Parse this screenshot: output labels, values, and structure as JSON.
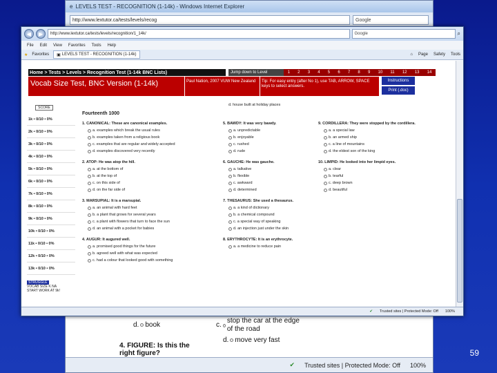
{
  "back_window": {
    "title": "LEVELS TEST - RECOGNITION (1-14k) - Windows Internet Explorer",
    "address": "http://www.lextutor.ca/tests/levels/recog",
    "search_placeholder": "Google",
    "page_lines": [
      {
        "id": "d",
        "text": "book"
      },
      {
        "id": "c",
        "text": "stop the car at the edge of the road"
      },
      {
        "id": "d2",
        "text": "move very fast"
      },
      {
        "id": "q4",
        "text": "4. FIGURE: Is this the right figure?"
      }
    ],
    "status_zone": "Trusted sites | Protected Mode: Off",
    "zoom": "100%"
  },
  "front_window": {
    "address": "http://www.lextutor.ca/tests/levels/recognition/1_14k/",
    "search_placeholder": "Google",
    "menu": [
      "File",
      "Edit",
      "View",
      "Favorites",
      "Tools",
      "Help"
    ],
    "favorites": "Favorites",
    "tab": "LEVELS TEST - RECOGNITION (1-14k)",
    "tools": [
      "Page",
      "Safety",
      "Tools"
    ],
    "status_zone": "Trusted sites | Protected Mode: Off",
    "zoom": "100%"
  },
  "page": {
    "breadcrumb": "Home > Tests > Levels > Recognition Test (1-14k BNC Lists)",
    "jump_label": "Jump down to Level",
    "levels": [
      "1",
      "2",
      "3",
      "4",
      "5",
      "6",
      "7",
      "8",
      "9",
      "10",
      "11",
      "12",
      "13",
      "14"
    ],
    "title": "Vocab Size Test, BNC Version (1-14k)",
    "author": "Paul Nation, 2007 VUW New Zealand",
    "tip": "Tip: For easy entry (after No 1), use TAB, ARROW, SPACE keys to select answers.",
    "instructions": "Instructions",
    "print": "Print (.doc)",
    "score": "SCORE",
    "levels_sidebar": [
      "1k • 0/10 • 0%",
      "2k • 0/10 • 0%",
      "3k • 0/10 • 0%",
      "4k • 0/10 • 0%",
      "5k • 0/10 • 0%",
      "6k • 0/10 • 0%",
      "7k • 0/10 • 0%",
      "8k • 0/10 • 0%",
      "9k • 0/10 • 0%",
      "10k • 0/10 • 0%",
      "11k • 0/10 • 0%",
      "12k • 0/10 • 0%",
      "13k • 0/10 • 0%"
    ],
    "struggle": {
      "label": "STRUGGLE",
      "text": "VOCAB SIZE K NA START WORK AT 9k!"
    },
    "carry_over": "d. house built at holiday places",
    "section": "Fourteenth 1000",
    "col1": [
      {
        "h": "1. CANONICAL: These are canonical examples.",
        "o": [
          "a. examples which break the usual rules",
          "b. examples taken from a religious book",
          "c. examples that are regular and widely accepted",
          "d. examples discovered very recently"
        ]
      },
      {
        "h": "2. ATOP: He was atop the hill.",
        "o": [
          "a. at the bottom of",
          "b. at the top of",
          "c. on this side of",
          "d. on the far side of"
        ]
      },
      {
        "h": "3. MARSUPIAL: It is a marsupial.",
        "o": [
          "a. an animal with hard feet",
          "b. a plant that grows for several years",
          "c. a plant with flowers that turn to face the sun",
          "d. an animal with a pocket for babies"
        ]
      },
      {
        "h": "4. AUGUR: It augured well.",
        "o": [
          "a. promised good things for the future",
          "b. agreed well with what was expected",
          "c. had a colour that looked good with something"
        ]
      }
    ],
    "col2": [
      {
        "h": "5. BAWDY: It was very bawdy.",
        "o": [
          "a. unpredictable",
          "b. enjoyable",
          "c. rushed",
          "d. rude"
        ]
      },
      {
        "h": "6. GAUCHE: He was gauche.",
        "o": [
          "a. talkative",
          "b. flexible",
          "c. awkward",
          "d. determined"
        ]
      },
      {
        "h": "7. THESAURUS: She used a thesaurus.",
        "o": [
          "a. a kind of dictionary",
          "b. a chemical compound",
          "c. a special way of speaking",
          "d. an injection just under the skin"
        ]
      },
      {
        "h": "8. ERYTHROCYTE: It is an erythrocyte.",
        "o": [
          "a. a medicine to reduce pain"
        ]
      }
    ],
    "col3": [
      {
        "h": "9. CORDILLERA: They were stopped by the cordillera.",
        "o": [
          "a. a special law",
          "b. an armed ship",
          "c. a line of mountains",
          "d. the eldest son of the king"
        ]
      },
      {
        "h": "10. LIMPID: He looked into her limpid eyes.",
        "o": [
          "a. clear",
          "b. tearful",
          "c. deep brown",
          "d. beautiful"
        ]
      }
    ]
  },
  "slide_number": "59"
}
